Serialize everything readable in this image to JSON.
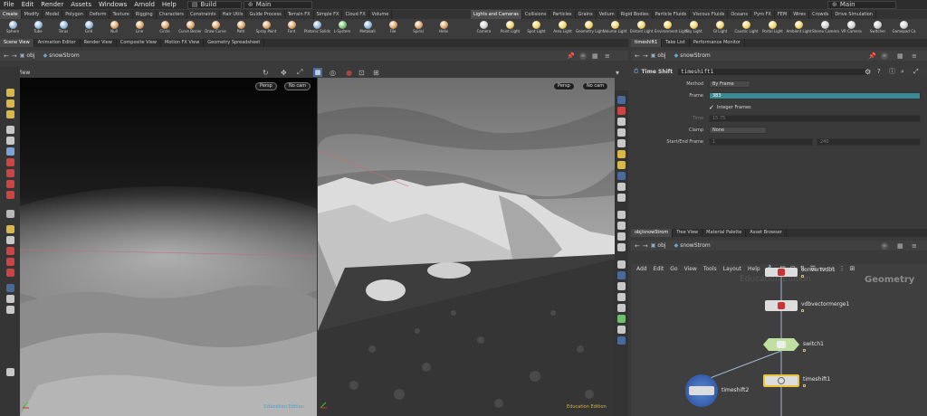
{
  "menu": [
    "File",
    "Edit",
    "Render",
    "Assets",
    "Windows",
    "Arnold",
    "Help"
  ],
  "build_label": "Build",
  "main_label": "Main",
  "right_main_label": "Main",
  "shelf_tabs_left": [
    {
      "label": "Create",
      "active": true
    },
    {
      "label": "Modify"
    },
    {
      "label": "Model"
    },
    {
      "label": "Polygon"
    },
    {
      "label": "Deform"
    },
    {
      "label": "Texture"
    },
    {
      "label": "Rigging"
    },
    {
      "label": "Characters"
    },
    {
      "label": "Constraints"
    },
    {
      "label": "Hair Utils"
    },
    {
      "label": "Guide Process"
    },
    {
      "label": "Terrain FX"
    },
    {
      "label": "Simple FX"
    },
    {
      "label": "Cloud FX"
    },
    {
      "label": "Volume"
    }
  ],
  "shelf_tabs_right": [
    {
      "label": "Lights and Cameras",
      "active": true
    },
    {
      "label": "Collisions"
    },
    {
      "label": "Particles"
    },
    {
      "label": "Grains"
    },
    {
      "label": "Vellum"
    },
    {
      "label": "Rigid Bodies"
    },
    {
      "label": "Particle Fluids"
    },
    {
      "label": "Viscous Fluids"
    },
    {
      "label": "Oceans"
    },
    {
      "label": "Pyro FX"
    },
    {
      "label": "FEM"
    },
    {
      "label": "Wires"
    },
    {
      "label": "Crowds"
    },
    {
      "label": "Drive Simulation"
    }
  ],
  "tools_left": [
    {
      "label": "Sphere",
      "color": "#8fb4d9"
    },
    {
      "label": "Tube",
      "color": "#8fb4d9"
    },
    {
      "label": "Torus",
      "color": "#8fb4d9"
    },
    {
      "label": "Grid",
      "color": "#8fb4d9"
    },
    {
      "label": "Null",
      "color": "#d9a060"
    },
    {
      "label": "Line",
      "color": "#d9a060"
    },
    {
      "label": "Circle",
      "color": "#d9a060"
    },
    {
      "label": "Curve Bezier",
      "color": "#d9a060"
    },
    {
      "label": "Draw Curve",
      "color": "#d9a060"
    },
    {
      "label": "Path",
      "color": "#d9a060"
    },
    {
      "label": "Spray Paint",
      "color": "#d9a060"
    },
    {
      "label": "Font",
      "color": "#d9a060"
    },
    {
      "label": "Platonic Solids",
      "color": "#8fb4d9"
    },
    {
      "label": "L-System",
      "color": "#6fbf6f"
    },
    {
      "label": "Metaball",
      "color": "#8fb4d9"
    },
    {
      "label": "File",
      "color": "#d9a060"
    },
    {
      "label": "Spiral",
      "color": "#d9a060"
    },
    {
      "label": "Helix",
      "color": "#d9a060"
    }
  ],
  "tools_right": [
    {
      "label": "Camera",
      "color": "#cfcfcf"
    },
    {
      "label": "Point Light",
      "color": "#f0d060"
    },
    {
      "label": "Spot Light",
      "color": "#f0d060"
    },
    {
      "label": "Area Light",
      "color": "#f0d060"
    },
    {
      "label": "Geometry Light",
      "color": "#f0d060"
    },
    {
      "label": "Volume Light",
      "color": "#f0d060"
    },
    {
      "label": "Distant Light",
      "color": "#f0d060"
    },
    {
      "label": "Environment Light",
      "color": "#f0d060"
    },
    {
      "label": "Sky Light",
      "color": "#f0d060"
    },
    {
      "label": "GI Light",
      "color": "#f0d060"
    },
    {
      "label": "Caustic Light",
      "color": "#f0d060"
    },
    {
      "label": "Portal Light",
      "color": "#f0d060"
    },
    {
      "label": "Ambient Light",
      "color": "#f0d060"
    },
    {
      "label": "Stereo Camera",
      "color": "#cfcfcf"
    },
    {
      "label": "VR Camera",
      "color": "#cfcfcf"
    },
    {
      "label": "Switcher",
      "color": "#cfcfcf"
    },
    {
      "label": "Gamepad Ca",
      "color": "#cfcfcf"
    }
  ],
  "left_pane_tabs": [
    {
      "label": "Scene View",
      "active": true
    },
    {
      "label": "Animation Editor"
    },
    {
      "label": "Render View"
    },
    {
      "label": "Composite View"
    },
    {
      "label": "Motion FX View"
    },
    {
      "label": "Geometry Spreadsheet"
    }
  ],
  "right_top_tabs": [
    {
      "label": "timeshift1",
      "active": true
    },
    {
      "label": "Take List"
    },
    {
      "label": "Performance Monitor"
    }
  ],
  "right_bottom_tabs": [
    {
      "label": "obj/snowStrom",
      "active": true
    },
    {
      "label": "Tree View"
    },
    {
      "label": "Material Palette"
    },
    {
      "label": "Asset Browser"
    }
  ],
  "path": {
    "obj": "obj",
    "node": "snowStrom"
  },
  "viewport": {
    "title": "View",
    "persp": "Persp",
    "cam": "No cam",
    "watermark": "Education Edition"
  },
  "params": {
    "type_label": "Time Shift",
    "node_name": "timeshift1",
    "rows": {
      "method": {
        "label": "Method",
        "value": "By Frame"
      },
      "frame": {
        "label": "Frame",
        "value": "383"
      },
      "integer": {
        "label": "Integer Frames",
        "checked": true
      },
      "time": {
        "label": "Time",
        "value": "15.75"
      },
      "clamp": {
        "label": "Clamp",
        "value": "None"
      },
      "startend": {
        "label": "Start/End Frame",
        "start": "1",
        "end": "240"
      }
    },
    "accent": "#3a8a94"
  },
  "network": {
    "menu": [
      "Add",
      "Edit",
      "Go",
      "View",
      "Tools",
      "Layout",
      "Help"
    ],
    "context_label": "Geometry",
    "watermark": "Education Edition",
    "nodes": [
      {
        "name": "convertvdb1"
      },
      {
        "name": "vdbvectormerge1"
      },
      {
        "name": "switch1"
      },
      {
        "name": "timeshift1"
      },
      {
        "name": "timeshift2"
      }
    ]
  }
}
